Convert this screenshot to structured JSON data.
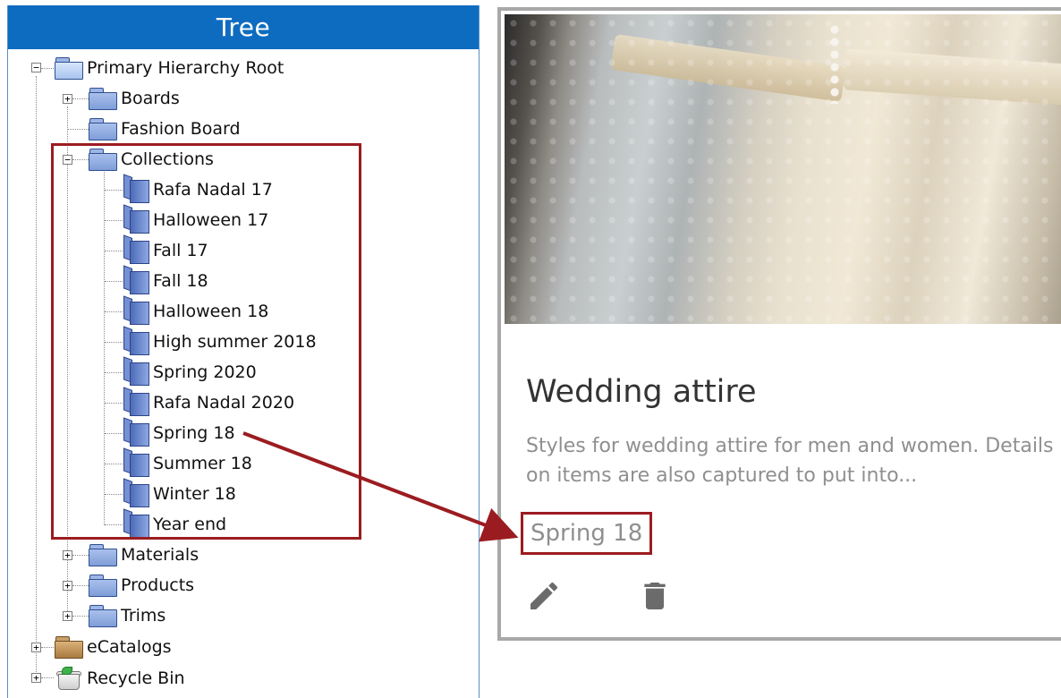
{
  "tree": {
    "header": "Tree",
    "nodes": {
      "root": "Primary Hierarchy Root",
      "boards": "Boards",
      "fashion_board": "Fashion Board",
      "collections": "Collections",
      "materials": "Materials",
      "products": "Products",
      "trims": "Trims",
      "ecatalogs": "eCatalogs",
      "recycle_bin": "Recycle Bin"
    },
    "collections_items": [
      "Rafa Nadal 17",
      "Halloween 17",
      "Fall 17",
      "Fall 18",
      "Halloween 18",
      "High summer 2018",
      "Spring 2020",
      "Rafa Nadal 2020",
      "Spring 18",
      "Summer 18",
      "Winter 18",
      "Year end"
    ],
    "expander_collapsed": "+",
    "expander_expanded": "−"
  },
  "card": {
    "title": "Wedding attire",
    "description": "Styles for wedding attire for men and women. Details on items are also captured to put into...",
    "tag": "Spring 18",
    "actions": {
      "edit_icon": "pencil-icon",
      "delete_icon": "trash-icon"
    }
  },
  "annotation": {
    "color": "#9b1c20"
  },
  "colors": {
    "tree_header_bg": "#0d6cc0",
    "card_border": "#a8a8a8",
    "muted_text": "#8f8f8f"
  }
}
